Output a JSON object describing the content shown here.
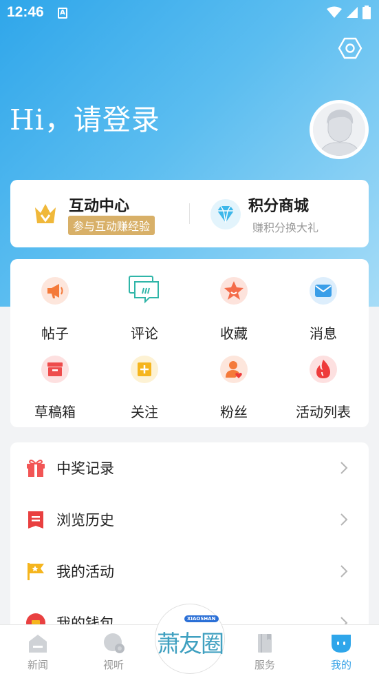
{
  "status_bar": {
    "time": "12:46",
    "notification_letter": "A"
  },
  "header": {
    "greeting": "Hi，请登录"
  },
  "top_card": {
    "left": {
      "title": "互动中心",
      "subtitle": "参与互动赚经验",
      "icon": "crown-icon",
      "color": "#f0b83a"
    },
    "right": {
      "title": "积分商城",
      "subtitle": "赚积分换大礼",
      "icon": "diamond-icon",
      "color": "#3db7ea"
    }
  },
  "grid": [
    {
      "label": "帖子",
      "icon": "megaphone-icon",
      "color": "#f47a3a"
    },
    {
      "label": "评论",
      "icon": "comment-icon",
      "color": "#2fb5a8"
    },
    {
      "label": "收藏",
      "icon": "star-icon",
      "color": "#f46c4a"
    },
    {
      "label": "消息",
      "icon": "mail-icon",
      "color": "#3a9ee8"
    },
    {
      "label": "草稿箱",
      "icon": "drafts-box-icon",
      "color": "#ee4b4b"
    },
    {
      "label": "关注",
      "icon": "plus-icon",
      "color": "#f5b51e"
    },
    {
      "label": "粉丝",
      "icon": "fans-icon",
      "color": "#f47a3a"
    },
    {
      "label": "活动列表",
      "icon": "fire-icon",
      "color": "#ee3b3b"
    }
  ],
  "menu": [
    {
      "label": "中奖记录",
      "icon": "gift-icon",
      "color": "#f25555"
    },
    {
      "label": "浏览历史",
      "icon": "history-icon",
      "color": "#e94040"
    },
    {
      "label": "我的活动",
      "icon": "flag-icon",
      "color": "#f5b51e"
    },
    {
      "label": "我的钱包",
      "icon": "wallet-icon",
      "color": "#e94040"
    }
  ],
  "tabs": [
    {
      "label": "新闻",
      "icon": "home-icon"
    },
    {
      "label": "视听",
      "icon": "media-icon"
    },
    {
      "label": "服务",
      "icon": "book-icon"
    },
    {
      "label": "我的",
      "icon": "profile-icon",
      "active": true
    }
  ],
  "center_tab": {
    "text": "萧友圈",
    "badge": "XIAOSHAN"
  }
}
